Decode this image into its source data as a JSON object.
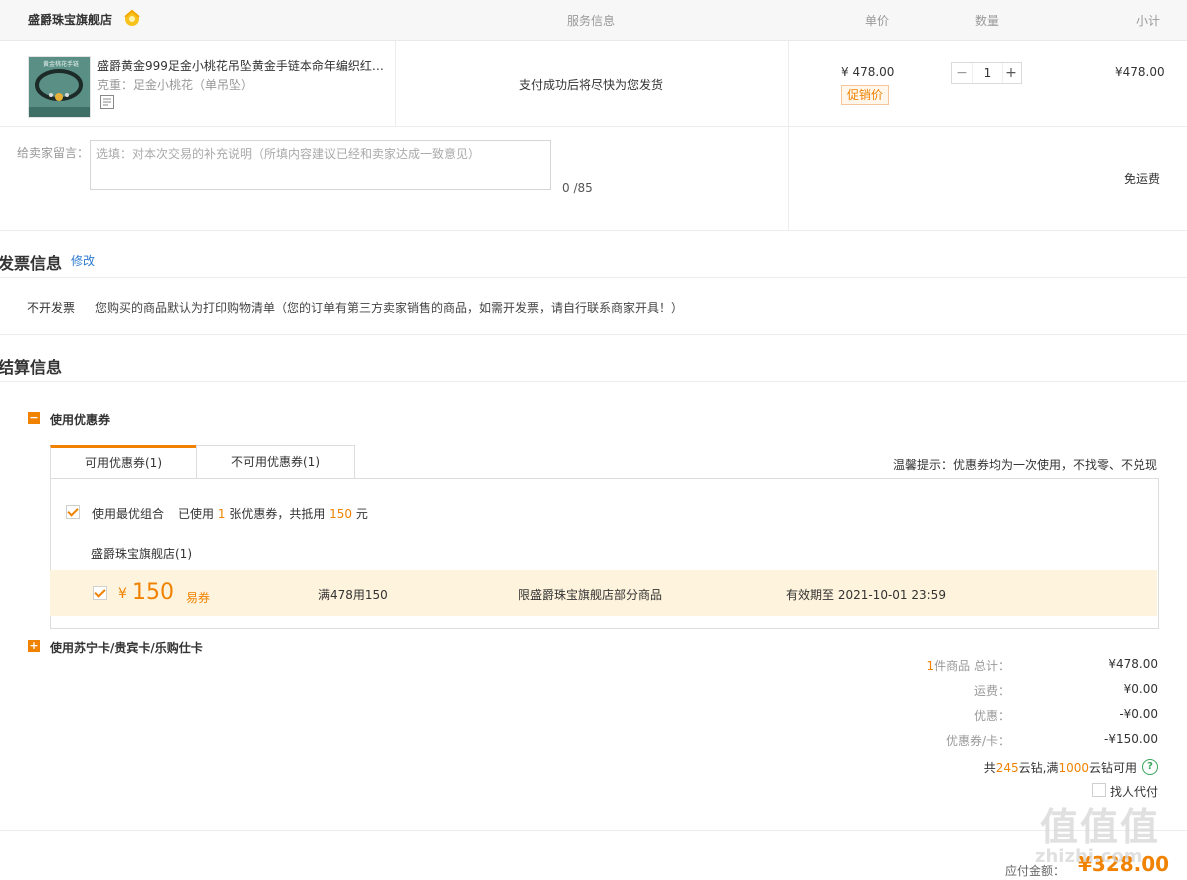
{
  "header": {
    "shop_name": "盛爵珠宝旗舰店",
    "col_service": "服务信息",
    "col_price": "单价",
    "col_qty": "数量",
    "col_subtotal": "小计"
  },
  "product": {
    "title": "盛爵黄金999足金小桃花吊坠黄金手链本命年编织红…",
    "weight": "克重：足金小桃花（单吊坠）",
    "service": "支付成功后将尽快为您发货",
    "price": "¥ 478.00",
    "promo_tag": "促销价",
    "qty": "1",
    "subtotal": "¥478.00",
    "thumb_text": "黄金桃花手链"
  },
  "message": {
    "label": "给卖家留言：",
    "placeholder": "选填：对本次交易的补充说明（所填内容建议已经和卖家达成一致意见）",
    "counter": "0 /85",
    "shipping": "免运费"
  },
  "invoice": {
    "title": "发票信息",
    "edit": "修改",
    "type": "不开发票",
    "note": "您购买的商品默认为打印购物清单（您的订单有第三方卖家销售的商品，如需开发票，请自行联系商家开具！）"
  },
  "settlement": {
    "title": "结算信息",
    "coupon_section": "使用优惠券",
    "tab_available": "可用优惠券(1)",
    "tab_unavailable": "不可用优惠券(1)",
    "tip": "温馨提示：优惠券均为一次使用，不找零、不兑现",
    "best_combo": "使用最优组合",
    "used_prefix": "已使用",
    "used_count": "1",
    "used_mid": "张优惠券，共抵用",
    "used_amount": "150",
    "used_suffix": "元",
    "store": "盛爵珠宝旗舰店(1)",
    "coupon": {
      "symbol": "¥",
      "amount": "150",
      "type": "易券",
      "condition": "满478用150",
      "scope": "限盛爵珠宝旗舰店部分商品",
      "expiry": "有效期至 2021-10-01 23:59"
    },
    "card_section": "使用苏宁卡/贵宾卡/乐购仕卡"
  },
  "summary": {
    "count": "1",
    "count_suffix": "件商品 总计：",
    "total": "¥478.00",
    "shipping_label": "运费：",
    "shipping": "¥0.00",
    "discount_label": "优惠：",
    "discount": "-¥0.00",
    "coupon_label": "优惠券/卡：",
    "coupon": "-¥150.00",
    "yz_prefix": "共",
    "yz_count": "245",
    "yz_mid": "云钻,满",
    "yz_min": "1000",
    "yz_suffix": "云钻可用",
    "pay_for_me": "找人代付",
    "payable_label": "应付金额：",
    "payable": "¥328.00"
  },
  "watermark": {
    "mark": "值值值",
    "domain": "zhizhi.com"
  },
  "colors": {
    "accent": "#f08200",
    "coupon_bg": "#fef3dc"
  }
}
